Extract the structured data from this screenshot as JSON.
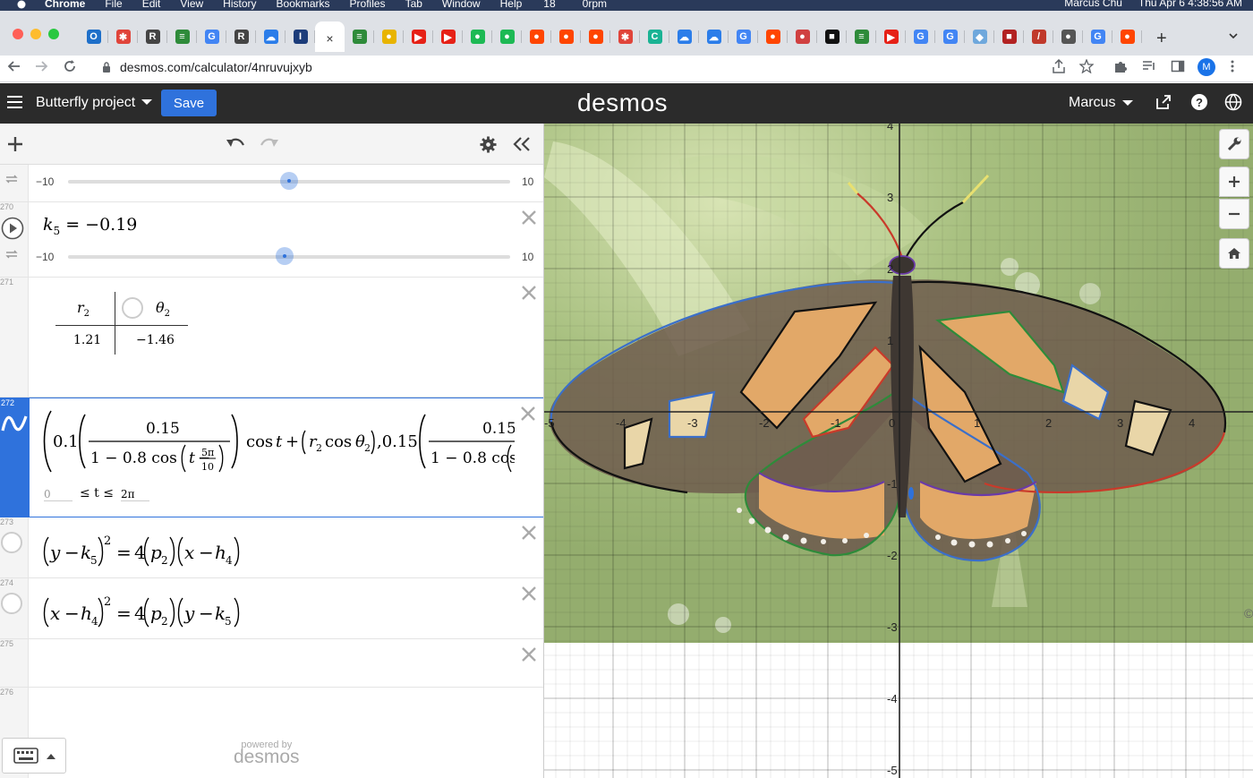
{
  "menubar": {
    "app": "Chrome",
    "items": [
      "File",
      "Edit",
      "View",
      "History",
      "Bookmarks",
      "Profiles",
      "Tab",
      "Window",
      "Help"
    ],
    "status_count": "18",
    "rpm": "0rpm",
    "user": "Marcus Chu",
    "clock": "Thu Apr 6  4:38:56 AM"
  },
  "tabs": [
    {
      "letter": "O",
      "color": "#1e6fc9"
    },
    {
      "letter": "✱",
      "color": "#e0443a"
    },
    {
      "letter": "R",
      "color": "#444444"
    },
    {
      "letter": "≡",
      "color": "#2e8b3a"
    },
    {
      "letter": "G",
      "color": "#4285f4"
    },
    {
      "letter": "R",
      "color": "#444444"
    },
    {
      "letter": "☁",
      "color": "#2b7de9"
    },
    {
      "letter": "I",
      "color": "#1c3c7a"
    },
    {
      "letter": "×",
      "color": "#ffffff",
      "active": true
    },
    {
      "letter": "≡",
      "color": "#2e8b3a"
    },
    {
      "letter": "●",
      "color": "#e8b400"
    },
    {
      "letter": "▶",
      "color": "#e62117"
    },
    {
      "letter": "▶",
      "color": "#e62117"
    },
    {
      "letter": "●",
      "color": "#1db954"
    },
    {
      "letter": "●",
      "color": "#1db954"
    },
    {
      "letter": "●",
      "color": "#ff4500"
    },
    {
      "letter": "●",
      "color": "#ff4500"
    },
    {
      "letter": "●",
      "color": "#ff4500"
    },
    {
      "letter": "✱",
      "color": "#e0443a"
    },
    {
      "letter": "C",
      "color": "#1ab394"
    },
    {
      "letter": "☁",
      "color": "#2b7de9"
    },
    {
      "letter": "☁",
      "color": "#2b7de9"
    },
    {
      "letter": "G",
      "color": "#4285f4"
    },
    {
      "letter": "●",
      "color": "#ff4500"
    },
    {
      "letter": "●",
      "color": "#d04040"
    },
    {
      "letter": "■",
      "color": "#111111"
    },
    {
      "letter": "≡",
      "color": "#2e8b3a"
    },
    {
      "letter": "▶",
      "color": "#e62117"
    },
    {
      "letter": "G",
      "color": "#4285f4"
    },
    {
      "letter": "G",
      "color": "#4285f4"
    },
    {
      "letter": "◆",
      "color": "#6fa8dc"
    },
    {
      "letter": "■",
      "color": "#b22222"
    },
    {
      "letter": "/",
      "color": "#c0392b"
    },
    {
      "letter": "●",
      "color": "#555555"
    },
    {
      "letter": "G",
      "color": "#4285f4"
    },
    {
      "letter": "●",
      "color": "#ff4500"
    }
  ],
  "address": {
    "url": "desmos.com/calculator/4nruvujxyb",
    "profile_initial": "M"
  },
  "header": {
    "project_title": "Butterfly project",
    "save_label": "Save",
    "logo": "desmos",
    "user": "Marcus"
  },
  "expressions": {
    "slider_top": {
      "min": "−10",
      "max": "10",
      "fraction": 0.5
    },
    "e270": {
      "number": "270",
      "var": "k",
      "sub": "5",
      "value": "= −0.19",
      "min": "−10",
      "max": "10",
      "fraction": 0.49
    },
    "e271": {
      "number": "271",
      "col1": "r",
      "col1_sub": "2",
      "col2": "θ",
      "col2_sub": "2",
      "v1": "1.21",
      "v2": "−1.46"
    },
    "e272": {
      "number": "272",
      "t_min": "0",
      "t_le": "≤ t ≤",
      "t_max": "2π"
    },
    "e273": {
      "number": "273"
    },
    "e274": {
      "number": "274"
    },
    "e275": {
      "number": "275"
    },
    "e276": {
      "number": "276"
    }
  },
  "powered_by": {
    "line1": "powered by",
    "line2": "desmos"
  },
  "graph": {
    "x_ticks": [
      "-5",
      "-4",
      "-3",
      "-2",
      "-1",
      "0",
      "1",
      "2",
      "3",
      "4"
    ],
    "y_ticks": [
      "4",
      "3",
      "2",
      "1",
      "-1",
      "-2",
      "-3",
      "-4",
      "-5"
    ],
    "corner_mark": "©"
  }
}
